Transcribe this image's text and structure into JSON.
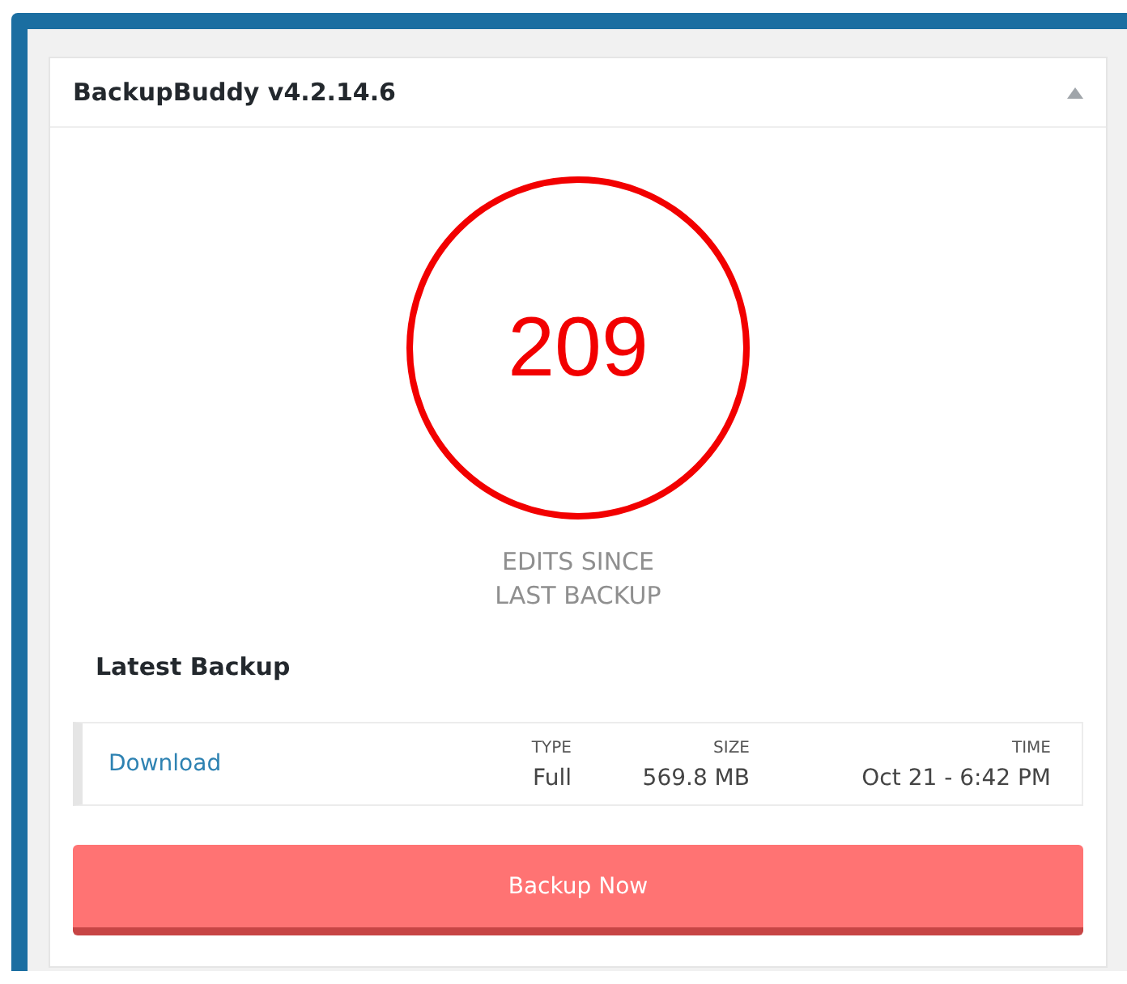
{
  "widget": {
    "title": "BackupBuddy v4.2.14.6",
    "expanded": true
  },
  "counter": {
    "value": "209",
    "label": "EDITS SINCE LAST BACKUP"
  },
  "latest_backup": {
    "heading": "Latest Backup",
    "link": "Download",
    "columns": [
      {
        "header": "TYPE",
        "value": "Full"
      },
      {
        "header": "SIZE",
        "value": "569.8 MB"
      },
      {
        "header": "TIME",
        "value": "Oct 21 - 6:42 PM"
      }
    ]
  },
  "buttons": [
    "Backup Now"
  ]
}
